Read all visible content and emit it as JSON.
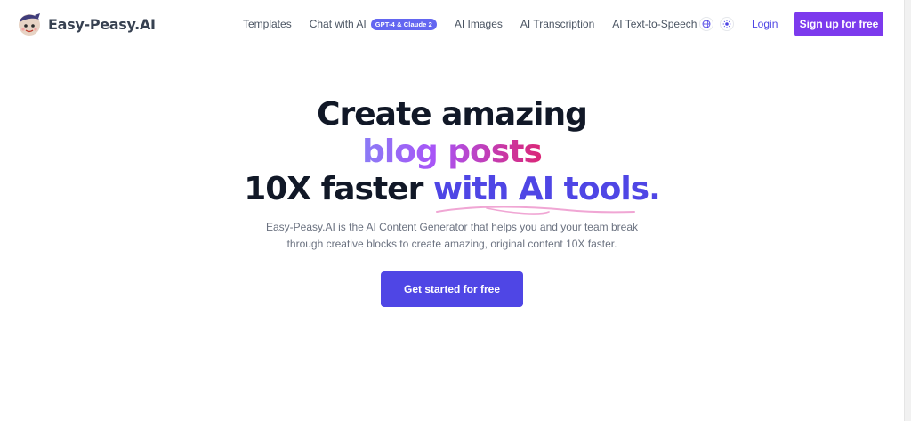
{
  "header": {
    "brand": "Easy-Peasy.AI",
    "nav": [
      {
        "label": "Templates"
      },
      {
        "label": "Chat with AI",
        "badge": "GPT-4 & Claude 2"
      },
      {
        "label": "AI Images"
      },
      {
        "label": "AI Transcription"
      },
      {
        "label": "AI Text-to-Speech"
      }
    ],
    "login": "Login",
    "signup": "Sign up for free"
  },
  "hero": {
    "line1": "Create amazing",
    "line2": "blog posts",
    "line3_plain": "10X faster",
    "line3_accent": "with AI tools.",
    "subtitle": "Easy-Peasy.AI is the AI Content Generator that helps you and your team break through creative blocks to create amazing, original content 10X faster.",
    "cta": "Get started for free"
  },
  "colors": {
    "primary": "#4f46e5",
    "signup": "#7c3aed",
    "badge": "#6366f1",
    "gradient_start": "#8b7cf6",
    "gradient_end": "#db2777",
    "underline": "#f0a6d4"
  }
}
